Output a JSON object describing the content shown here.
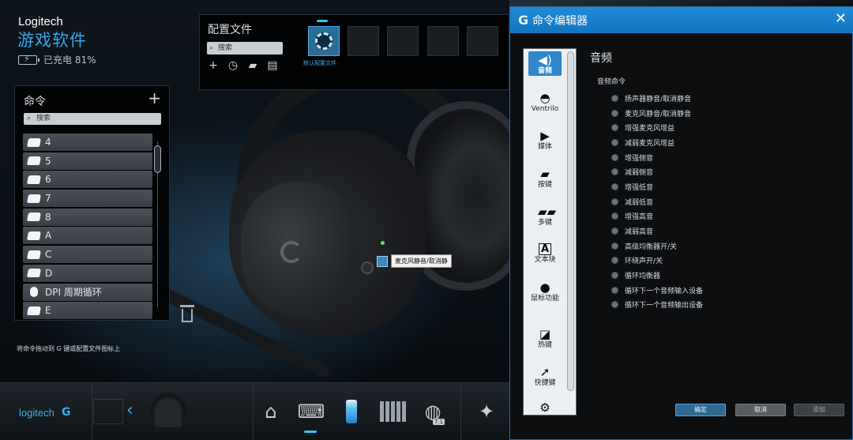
{
  "app": {
    "brand": "Logitech",
    "title": "游戏软件",
    "battery_text": "已充电 81%",
    "profiles": {
      "title": "配置文件",
      "search_placeholder": "搜索",
      "default_label": "默认配置文件",
      "tools": [
        "add-icon",
        "clock-icon",
        "folder-icon",
        "print-icon"
      ]
    },
    "commands": {
      "title": "命令",
      "add": "+",
      "search_placeholder": "搜索",
      "items": [
        {
          "label": "4",
          "icon": "key-icon"
        },
        {
          "label": "5",
          "icon": "key-icon"
        },
        {
          "label": "6",
          "icon": "key-icon"
        },
        {
          "label": "7",
          "icon": "key-icon"
        },
        {
          "label": "8",
          "icon": "key-icon"
        },
        {
          "label": "A",
          "icon": "key-icon"
        },
        {
          "label": "C",
          "icon": "key-icon"
        },
        {
          "label": "D",
          "icon": "key-icon"
        },
        {
          "label": "DPI 周期循环",
          "icon": "mouse-icon"
        },
        {
          "label": "E",
          "icon": "key-icon"
        }
      ]
    },
    "hint": "将命令拖动到 G 键或配置文件图标上",
    "tooltip": "麦克风静音/取消静",
    "bottom": {
      "logo": "logitech",
      "surround_badge": "7.1"
    }
  },
  "editor": {
    "title": "命令编辑器",
    "close": "✕",
    "categories": [
      {
        "label": "音频",
        "icon": "speaker-icon",
        "glyph": "🔊",
        "active": true
      },
      {
        "label": "Ventrilo",
        "icon": "ventrilo-icon",
        "glyph": "⛑",
        "active": false
      },
      {
        "label": "媒体",
        "icon": "play-icon",
        "glyph": "▶",
        "active": false
      },
      {
        "label": "按键",
        "icon": "key-icon",
        "glyph": "⌨",
        "active": false
      },
      {
        "label": "多键",
        "icon": "multikey-icon",
        "glyph": "⌨",
        "active": false
      },
      {
        "label": "文本块",
        "icon": "text-block-icon",
        "glyph": "A",
        "active": false
      },
      {
        "label": "鼠标功能",
        "icon": "mouse-icon",
        "glyph": "🖱",
        "active": false
      },
      {
        "label": "热键",
        "icon": "hotkey-icon",
        "glyph": "⚡",
        "active": false
      },
      {
        "label": "快捷键",
        "icon": "shortcut-icon",
        "glyph": "➚",
        "active": false
      },
      {
        "label": "",
        "icon": "function-icon",
        "glyph": "⚙",
        "active": false
      }
    ],
    "section_title": "音频",
    "sub_title": "音频命令",
    "audio_commands": [
      "扬声器静音/取消静音",
      "麦克风静音/取消静音",
      "增强麦克风增益",
      "减弱麦克风增益",
      "增强侧音",
      "减弱侧音",
      "增强低音",
      "减弱低音",
      "增强高音",
      "减弱高音",
      "高级均衡器开/关",
      "环绕声开/关",
      "循环均衡器",
      "循环下一个音频输入设备",
      "循环下一个音频输出设备"
    ],
    "buttons": {
      "ok": "确定",
      "cancel": "取消",
      "add": "添加"
    }
  }
}
